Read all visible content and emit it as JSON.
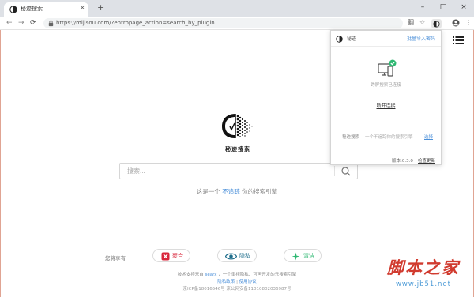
{
  "browser": {
    "tab_title": "秘迹搜索",
    "tab_close": "×",
    "new_tab": "+",
    "window_controls": [
      "–",
      "□",
      "×"
    ],
    "url": "https://mijisou.com/?entropage_action=search_by_plugin",
    "nav": [
      "←",
      "→",
      "⟳"
    ],
    "toolbar_icons": [
      "翻",
      "☆",
      "⋮"
    ]
  },
  "page": {
    "brand": "秘迹搜索",
    "search_placeholder": "搜索...",
    "tagline_prefix": "这是一个",
    "tagline_highlight": "不追踪",
    "tagline_suffix": "你的搜索引擎",
    "enjoy_label": "您将享有",
    "features": [
      {
        "label": "聚合",
        "color": "#d9263b"
      },
      {
        "label": "隐私",
        "color": "#1f6e8c"
      },
      {
        "label": "清洁",
        "color": "#2eb872"
      }
    ],
    "footer_line1_prefix": "技术支持来自",
    "footer_line1_link": "searx",
    "footer_line1_suffix": "，一个重視隐私、可再开发的元搜索引擎",
    "footer_privacy": "隐私政策",
    "footer_separator": "|",
    "footer_terms": "使用协议",
    "footer_icp": "京ICP备18016546号 京公网安备11010802036987号"
  },
  "popup": {
    "title": "秘迹",
    "import_label": "批量导入密码",
    "status": "跨屏搜索已连接",
    "disconnect": "断开连接",
    "row_label": "秘迹搜索",
    "row_desc": "一个不追踪你的搜索引擎",
    "row_link": "选择",
    "version": "版本:0.3.0",
    "update": "检查更新"
  },
  "watermark": {
    "main": "脚本之家",
    "sub": "www.jb51.net"
  },
  "colors": {
    "accent_link": "#4a8fd9",
    "check_green": "#2eb872",
    "watermark_red": "#d13b2f"
  }
}
